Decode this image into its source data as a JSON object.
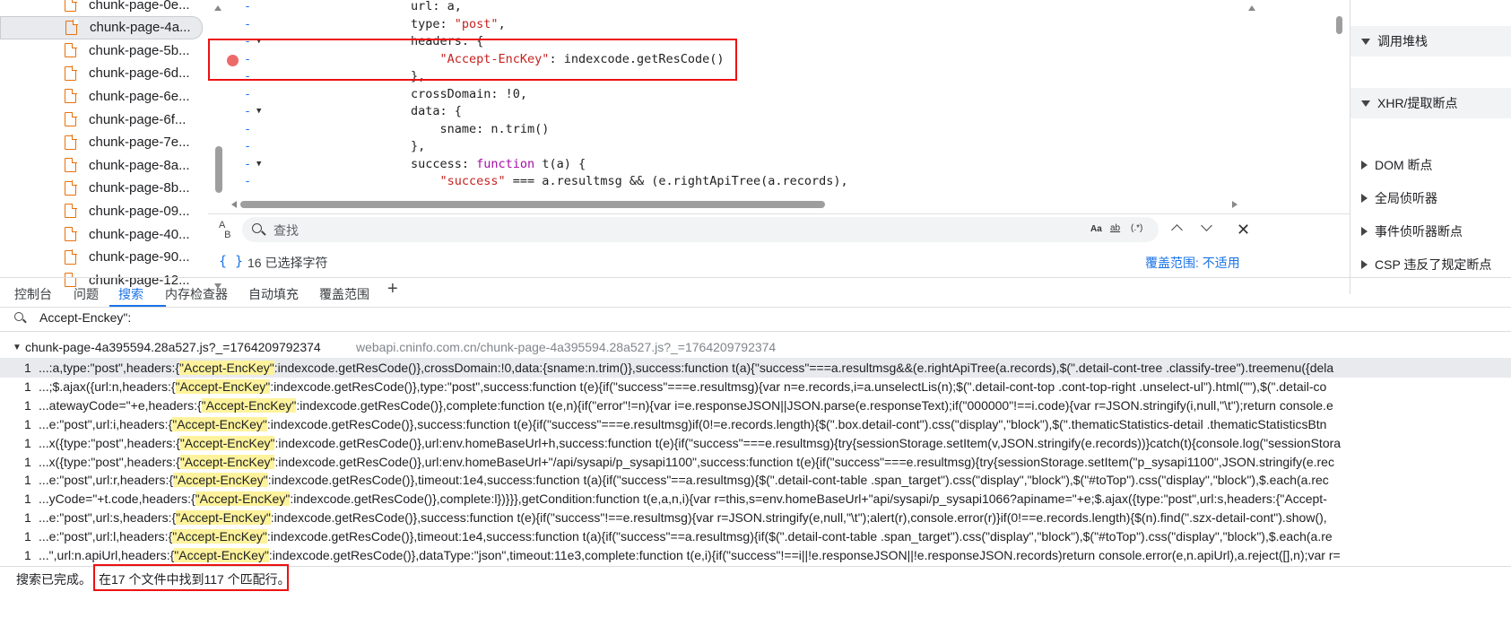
{
  "file_tree": {
    "items": [
      "chunk-page-0e...",
      "chunk-page-4a...",
      "chunk-page-5b...",
      "chunk-page-6d...",
      "chunk-page-6e...",
      "chunk-page-6f...",
      "chunk-page-7e...",
      "chunk-page-8a...",
      "chunk-page-8b...",
      "chunk-page-09...",
      "chunk-page-40...",
      "chunk-page-90...",
      "chunk-page-12..."
    ],
    "selected_index": 1
  },
  "editor": {
    "lines": [
      {
        "pre": "url: a,",
        "fold": ""
      },
      {
        "pre": "type: ",
        "str": "\"post\"",
        "post": ",",
        "fold": ""
      },
      {
        "pre": "headers: {",
        "fold": "▼"
      },
      {
        "pre": "    ",
        "str": "\"Accept-EncKey\"",
        "post": ": indexcode.getResCode()",
        "fold": ""
      },
      {
        "pre": "},",
        "fold": ""
      },
      {
        "pre": "crossDomain: !0,",
        "fold": ""
      },
      {
        "pre": "data: {",
        "fold": "▼"
      },
      {
        "pre": "    sname: n.trim()",
        "fold": ""
      },
      {
        "pre": "},",
        "fold": ""
      },
      {
        "pre": "success: ",
        "kw": "function",
        "post": " t(a) {",
        "fold": "▼"
      },
      {
        "pre": "    ",
        "str": "\"success\"",
        "post": " === a.resultmsg && (e.rightApiTree(a.records),",
        "fold": ""
      }
    ]
  },
  "find_bar": {
    "value": "查找",
    "match_case": "Aa",
    "whole_word": "ab",
    "regex": ".*"
  },
  "status": {
    "braces": "{ }",
    "selection": "16 已选择字符",
    "coverage": "覆盖范围: 不适用"
  },
  "right_pane": {
    "sections": [
      {
        "label": "调用堆栈",
        "open": true
      },
      {
        "label": "XHR/提取断点",
        "open": true
      },
      {
        "label": "DOM 断点",
        "open": false
      },
      {
        "label": "全局侦听器",
        "open": false
      },
      {
        "label": "事件侦听器断点",
        "open": false
      },
      {
        "label": "CSP 违反了规定断点",
        "open": false
      }
    ]
  },
  "drawer_tabs": [
    "控制台",
    "问题",
    "搜索",
    "内存检查器",
    "自动填充",
    "覆盖范围"
  ],
  "active_tab": "搜索",
  "search": {
    "query": "Accept-Enckey\":"
  },
  "result_file": {
    "name": "chunk-page-4a395594.28a527.js?_=1764209792374",
    "url": "webapi.cninfo.com.cn/chunk-page-4a395594.28a527.js?_=1764209792374"
  },
  "results": [
    {
      "num": "1",
      "pre": "...:a,type:\"post\",headers:{",
      "match": "\"Accept-EncKey\"",
      "post": ":indexcode.getResCode()},crossDomain:!0,data:{sname:n.trim()},success:function t(a){\"success\"===a.resultmsg&&(e.rightApiTree(a.records),$(\".detail-cont-tree .classify-tree\").treemenu({dela"
    },
    {
      "num": "1",
      "pre": "...;$.ajax({url:n,headers:{",
      "match": "\"Accept-EncKey\"",
      "post": ":indexcode.getResCode()},type:\"post\",success:function t(e){if(\"success\"===e.resultmsg){var n=e.records,i=a.unselectLis(n);$(\".detail-cont-top .cont-top-right .unselect-ul\").html(\"\"),$(\".detail-co"
    },
    {
      "num": "1",
      "pre": "...atewayCode=\"+e,headers:{",
      "match": "\"Accept-EncKey\"",
      "post": ":indexcode.getResCode()},complete:function t(e,n){if(\"error\"!=n){var i=e.responseJSON||JSON.parse(e.responseText);if(\"000000\"!==i.code){var r=JSON.stringify(i,null,\"\\t\");return console.e"
    },
    {
      "num": "1",
      "pre": "...e:\"post\",url:i,headers:{",
      "match": "\"Accept-EncKey\"",
      "post": ":indexcode.getResCode()},success:function t(e){if(\"success\"===e.resultmsg)if(0!=e.records.length){$(\".box.detail-cont\").css(\"display\",\"block\"),$(\".thematicStatistics-detail .thematicStatisticsBtn"
    },
    {
      "num": "1",
      "pre": "...x({type:\"post\",headers:{",
      "match": "\"Accept-EncKey\"",
      "post": ":indexcode.getResCode()},url:env.homeBaseUrl+h,success:function t(e){if(\"success\"===e.resultmsg){try{sessionStorage.setItem(v,JSON.stringify(e.records))}catch(t){console.log(\"sessionStora"
    },
    {
      "num": "1",
      "pre": "...x({type:\"post\",headers:{",
      "match": "\"Accept-EncKey\"",
      "post": ":indexcode.getResCode()},url:env.homeBaseUrl+\"/api/sysapi/p_sysapi1100\",success:function t(e){if(\"success\"===e.resultmsg){try{sessionStorage.setItem(\"p_sysapi1100\",JSON.stringify(e.rec"
    },
    {
      "num": "1",
      "pre": "...e:\"post\",url:r,headers:{",
      "match": "\"Accept-EncKey\"",
      "post": ":indexcode.getResCode()},timeout:1e4,success:function t(a){if(\"success\"==a.resultmsg){$(\".detail-cont-table .span_target\").css(\"display\",\"block\"),$(\"#toTop\").css(\"display\",\"block\"),$.each(a.rec"
    },
    {
      "num": "1",
      "pre": "...yCode=\"+t.code,headers:{",
      "match": "\"Accept-EncKey\"",
      "post": ":indexcode.getResCode()},complete:l})}}},getCondition:function t(e,a,n,i){var r=this,s=env.homeBaseUrl+\"api/sysapi/p_sysapi1066?apiname=\"+e;$.ajax({type:\"post\",url:s,headers:{\"Accept-"
    },
    {
      "num": "1",
      "pre": "...e:\"post\",url:s,headers:{",
      "match": "\"Accept-EncKey\"",
      "post": ":indexcode.getResCode()},success:function t(e){if(\"success\"!==e.resultmsg){var r=JSON.stringify(e,null,\"\\t\");alert(r),console.error(r)}if(0!==e.records.length){$(n).find(\".szx-detail-cont\").show(),"
    },
    {
      "num": "1",
      "pre": "...e:\"post\",url:l,headers:{",
      "match": "\"Accept-EncKey\"",
      "post": ":indexcode.getResCode()},timeout:1e4,success:function t(a){if(\"success\"==a.resultmsg){if($(\".detail-cont-table .span_target\").css(\"display\",\"block\"),$(\"#toTop\").css(\"display\",\"block\"),$.each(a.re"
    },
    {
      "num": "1",
      "pre": "...\",url:n.apiUrl,headers:{",
      "match": "\"Accept-EncKey\"",
      "post": ":indexcode.getResCode()},dataType:\"json\",timeout:11e3,complete:function t(e,i){if(\"success\"!==i||!e.responseJSON||!e.responseJSON.records)return console.error(e,n.apiUrl),a.reject([],n);var r="
    }
  ],
  "footer": {
    "status": "搜索已完成。",
    "summary": "在17 个文件中找到117 个匹配行。"
  },
  "colors": {
    "accent": "#1a73e8",
    "highlight_box": "#e11111",
    "match_bg": "#fef39c",
    "breakpoint": "#ec6a6a"
  }
}
